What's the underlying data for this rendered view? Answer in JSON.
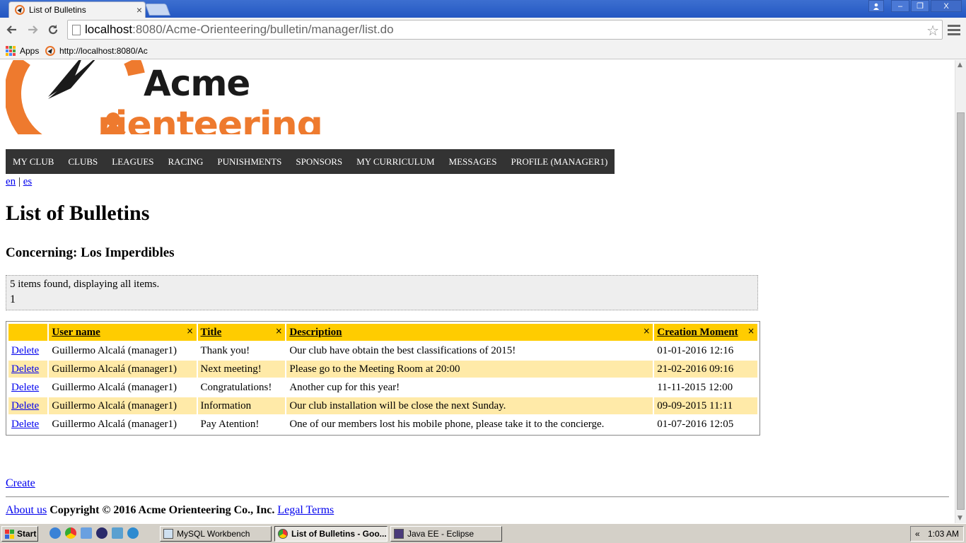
{
  "browser": {
    "tab_title": "List of Bulletins",
    "tab_close": "×",
    "url_host": "localhost",
    "url_path": ":8080/Acme-Orienteering/bulletin/manager/list.do",
    "bookmarks": [
      {
        "label": "Apps"
      },
      {
        "label": "http://localhost:8080/Ac"
      }
    ],
    "window_controls": {
      "minimize": "–",
      "restore": "❐",
      "close": "X"
    }
  },
  "logo": {
    "line1": "Acme",
    "line2": "rienteering"
  },
  "mainmenu": {
    "items": [
      "MY CLUB",
      "CLUBS",
      "LEAGUES",
      "RACING",
      "PUNISHMENTS",
      "SPONSORS",
      "MY CURRICULUM",
      "MESSAGES",
      "PROFILE (MANAGER1)"
    ]
  },
  "lang": {
    "en": "en",
    "sep": "|",
    "es": "es"
  },
  "page": {
    "title": "List of Bulletins",
    "subtitle": "Concerning: Los Imperdibles"
  },
  "pager": {
    "summary": "5 items found, displaying all items.",
    "pages": "1"
  },
  "table": {
    "headers": [
      "",
      "User name",
      "Title",
      "Description",
      "Creation Moment"
    ],
    "sort_mark": "×",
    "rows": [
      {
        "action": "Delete",
        "user": "Guillermo Alcalá (manager1)",
        "title": "Thank you!",
        "description": "Our club have obtain the best classifications of 2015!",
        "moment": "01-01-2016 12:16"
      },
      {
        "action": "Delete",
        "user": "Guillermo Alcalá (manager1)",
        "title": "Next meeting!",
        "description": "Please go to the Meeting Room at 20:00",
        "moment": "21-02-2016 09:16"
      },
      {
        "action": "Delete",
        "user": "Guillermo Alcalá (manager1)",
        "title": "Congratulations!",
        "description": "Another cup for this year!",
        "moment": "11-11-2015 12:00"
      },
      {
        "action": "Delete",
        "user": "Guillermo Alcalá (manager1)",
        "title": "Information",
        "description": "Our club installation will be close the next Sunday.",
        "moment": "09-09-2015 11:11"
      },
      {
        "action": "Delete",
        "user": "Guillermo Alcalá (manager1)",
        "title": "Pay Atention!",
        "description": "One of our members lost his mobile phone, please take it to the concierge.",
        "moment": "01-07-2016 12:05"
      }
    ]
  },
  "create_label": "Create",
  "footer": {
    "about": "About us",
    "copyright": "Copyright © 2016 Acme Orienteering Co., Inc.",
    "legal": "Legal Terms"
  },
  "taskbar": {
    "start": "Start",
    "tasks": [
      {
        "label": "MySQL Workbench"
      },
      {
        "label": "List of Bulletins - Goo..."
      },
      {
        "label": "Java EE - Eclipse"
      }
    ],
    "tray_arrow": "«",
    "clock": "1:03 AM"
  },
  "colors": {
    "menu_bg": "#333333",
    "header_bg": "#ffcc00",
    "row_alt_bg": "#ffeaa8",
    "logo_orange": "#ee7a2e",
    "link": "#0000ee"
  }
}
